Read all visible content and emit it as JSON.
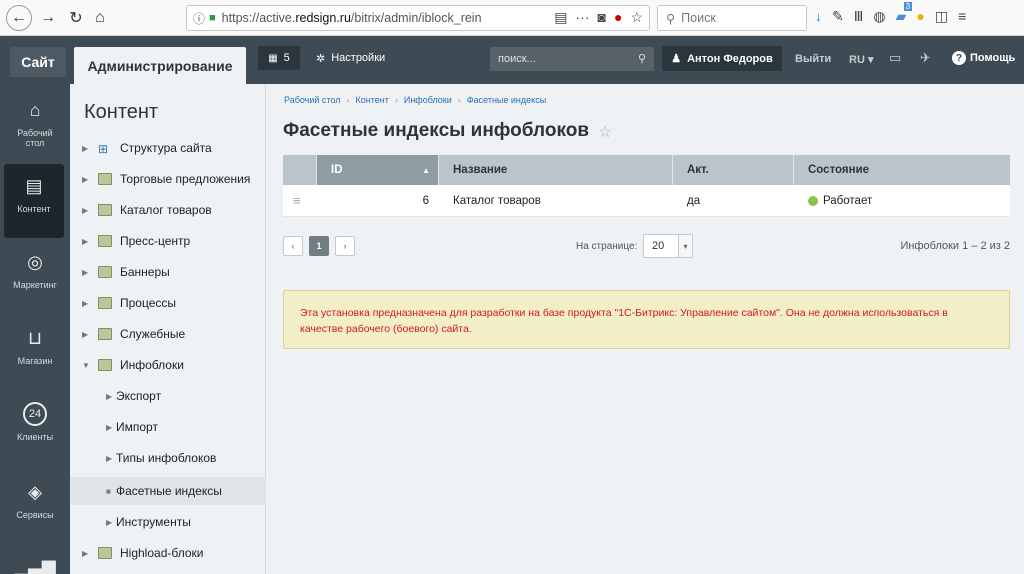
{
  "browser": {
    "url_prefix": "https://active.",
    "url_domain": "redsign.ru",
    "url_path": "/bitrix/admin/iblock_rein",
    "search_placeholder": "Поиск",
    "notif_badge": "3"
  },
  "topbar": {
    "site_tab": "Сайт",
    "admin_tab": "Администрирование",
    "notifications_count": "5",
    "settings_label": "Настройки",
    "search_placeholder": "поиск...",
    "user_name": "Антон Федоров",
    "exit_label": "Выйти",
    "lang_label": "RU",
    "help_label": "Помощь"
  },
  "leftmenu": {
    "items": [
      {
        "label": "Рабочий стол",
        "icon": "home-icon"
      },
      {
        "label": "Контент",
        "icon": "document-icon"
      },
      {
        "label": "Маркетинг",
        "icon": "target-icon"
      },
      {
        "label": "Магазин",
        "icon": "basket-icon"
      },
      {
        "label": "Клиенты",
        "icon": "clients-24-icon"
      },
      {
        "label": "Сервисы",
        "icon": "layers-icon"
      }
    ]
  },
  "submenu": {
    "title": "Контент",
    "items": [
      {
        "label": "Структура сайта"
      },
      {
        "label": "Торговые предложения"
      },
      {
        "label": "Каталог товаров"
      },
      {
        "label": "Пресс-центр"
      },
      {
        "label": "Баннеры"
      },
      {
        "label": "Процессы"
      },
      {
        "label": "Служебные"
      },
      {
        "label": "Инфоблоки"
      },
      {
        "label": "Экспорт"
      },
      {
        "label": "Импорт"
      },
      {
        "label": "Типы инфоблоков"
      },
      {
        "label": "Фасетные индексы"
      },
      {
        "label": "Инструменты"
      },
      {
        "label": "Highload-блоки"
      }
    ]
  },
  "breadcrumb": [
    "Рабочий стол",
    "Контент",
    "Инфоблоки",
    "Фасетные индексы"
  ],
  "page_title": "Фасетные индексы инфоблоков",
  "grid": {
    "columns": [
      "ID",
      "Название",
      "Акт.",
      "Состояние"
    ],
    "rows": [
      {
        "id": "6",
        "name": "Каталог товаров",
        "active": "да",
        "status": "Работает"
      }
    ]
  },
  "pager": {
    "prev": "‹",
    "current": "1",
    "next": "›",
    "per_page_label": "На странице:",
    "per_page_value": "20",
    "count_text": "Инфоблоки 1 – 2 из 2"
  },
  "warning": "Эта установка предназначена для разработки на базе продукта \"1С-Битрикс: Управление сайтом\". Она не должна использоваться в качестве рабочего (боевого) сайта.",
  "colors": {
    "topbar": "#3f4b54",
    "status_ok": "#8bc34a",
    "warning_text": "#d31a1a",
    "link": "#2a6fb4"
  }
}
